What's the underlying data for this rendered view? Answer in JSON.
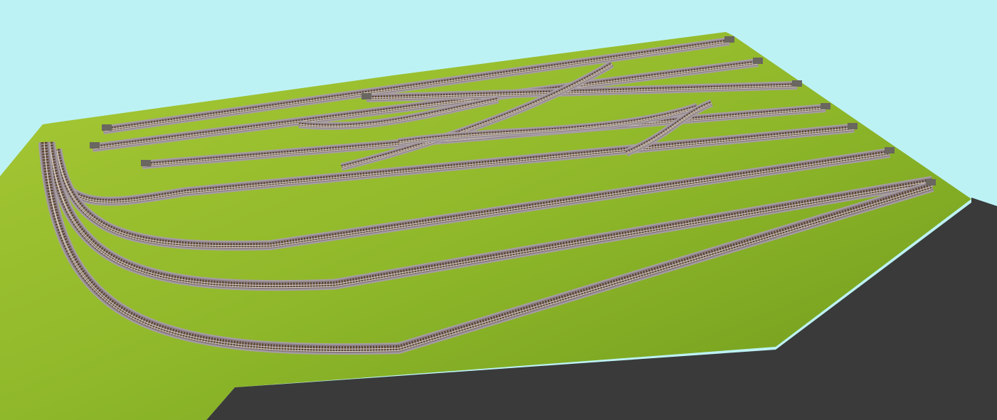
{
  "scene": {
    "colors": {
      "sky": "#bdf2f5",
      "board_top": "#8fb82a",
      "board_top_light": "#a8c935",
      "board_top_dark": "#6f9a1c",
      "board_side": "#3a3a3a",
      "board_side_dark": "#2e2e2e",
      "track_bed": "#8c8088",
      "track_bed_edge": "#a89ea4",
      "sleeper": "#5a4028",
      "rail": "#d8d0c0",
      "buffer_stop": "#6a6660"
    },
    "icons": {
      "buffer_stop": "buffer-stop-icon"
    }
  }
}
